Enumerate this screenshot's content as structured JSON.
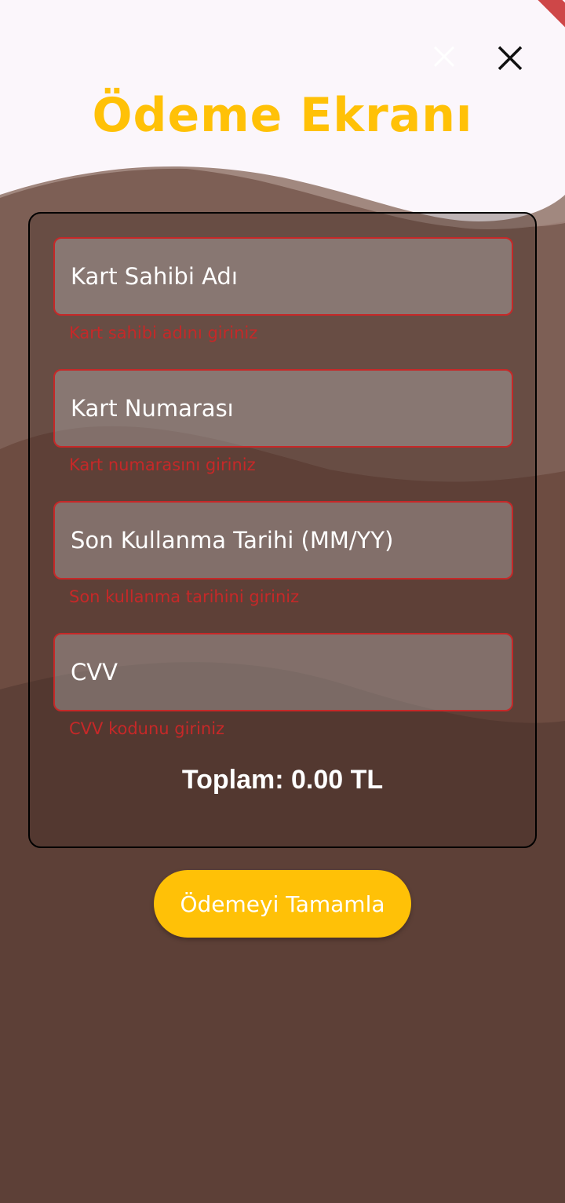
{
  "header": {
    "title": "Ödeme Ekranı",
    "close_icon": "close-icon",
    "faded_close_icon": "close-icon"
  },
  "form": {
    "fields": [
      {
        "placeholder": "Kart Sahibi Adı",
        "value": "",
        "error": "Kart sahibi adını giriniz"
      },
      {
        "placeholder": "Kart Numarası",
        "value": "",
        "error": "Kart numarasını giriniz"
      },
      {
        "placeholder": "Son Kullanma Tarihi (MM/YY)",
        "value": "",
        "error": "Son kullanma tarihini giriniz"
      },
      {
        "placeholder": "CVV",
        "value": "",
        "error": "CVV kodunu giriniz"
      }
    ],
    "total": "Toplam: 0.00 TL"
  },
  "actions": {
    "pay_label": "Ödemeyi Tamamla"
  },
  "colors": {
    "accent": "#ffc107",
    "background": "#5d4037",
    "error": "#c62828",
    "header_bg": "#fbf6fb"
  }
}
